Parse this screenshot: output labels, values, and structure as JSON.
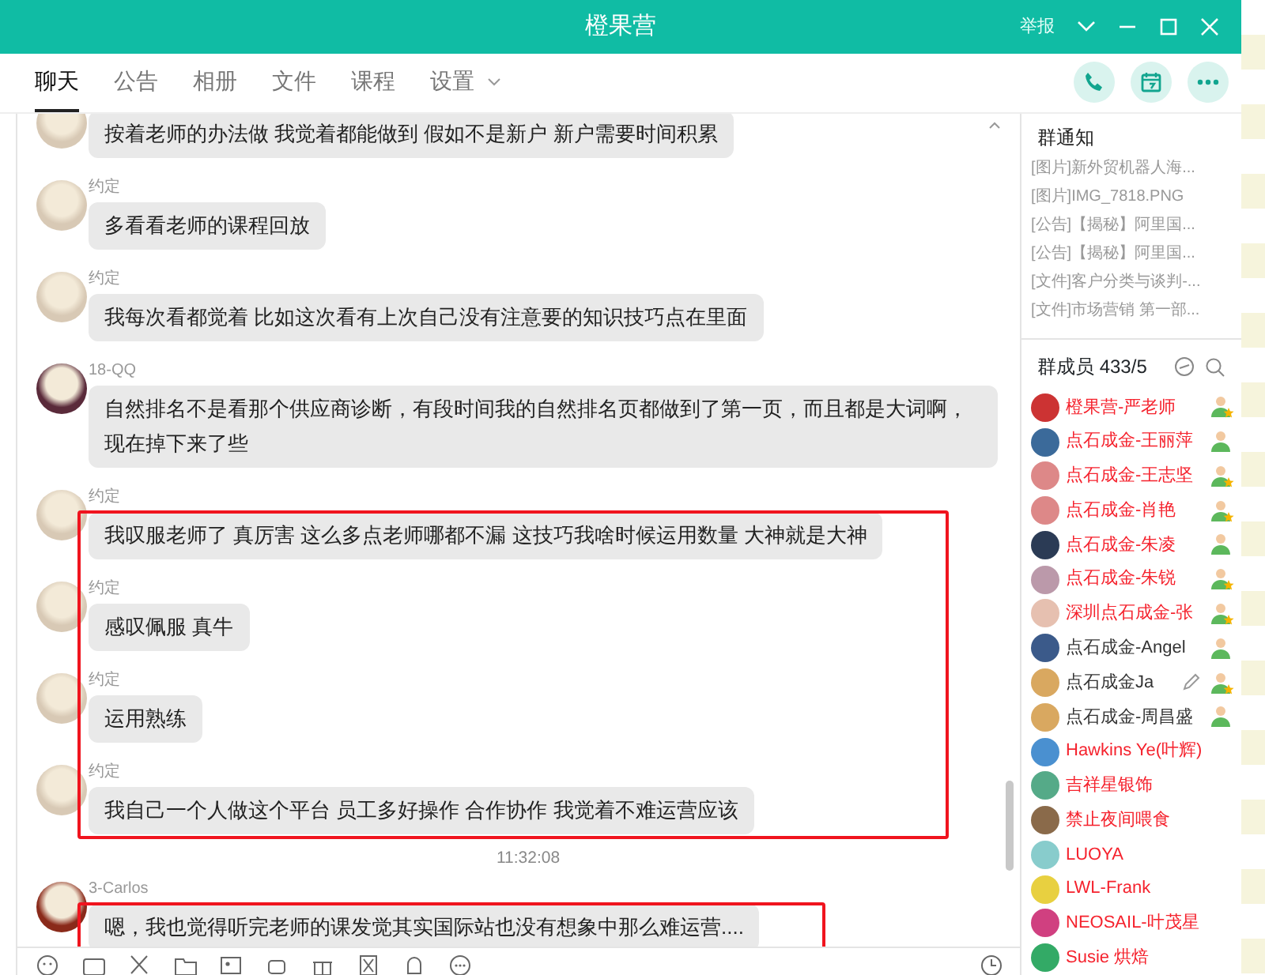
{
  "window": {
    "title": "橙果营",
    "report": "举报"
  },
  "tabs": [
    {
      "label": "聊天",
      "selected": true
    },
    {
      "label": "公告",
      "selected": false
    },
    {
      "label": "相册",
      "selected": false
    },
    {
      "label": "文件",
      "selected": false
    },
    {
      "label": "课程",
      "selected": false
    },
    {
      "label": "设置",
      "selected": false,
      "dropdown": true
    }
  ],
  "messages": [
    {
      "kind": "message",
      "text": "按着老师的办法做 我觉着都能做到 假如不是新户 新户需要时间积累",
      "highlighted": false
    },
    {
      "kind": "message",
      "sender": "约定",
      "text": "多看看老师的课程回放",
      "highlighted": false
    },
    {
      "kind": "message",
      "sender": "约定",
      "text": "我每次看都觉着 比如这次看有上次自己没有注意要的知识技巧点在里面",
      "highlighted": false
    },
    {
      "kind": "message",
      "sender": "18-QQ",
      "text": "自然排名不是看那个供应商诊断，有段时间我的自然排名页都做到了第一页，而且都是大词啊，现在掉下来了些",
      "highlighted": false
    },
    {
      "kind": "message",
      "sender": "约定",
      "text": "我叹服老师了 真厉害 这么多点老师哪都不漏 这技巧我啥时候运用数量 大神就是大神",
      "highlighted": true
    },
    {
      "kind": "message",
      "sender": "约定",
      "text": "感叹佩服 真牛",
      "highlighted": true
    },
    {
      "kind": "message",
      "sender": "约定",
      "text": "运用熟练",
      "highlighted": true
    },
    {
      "kind": "message",
      "sender": "约定",
      "text": "我自己一个人做这个平台 员工多好操作 合作协作 我觉着不难运营应该",
      "highlighted": true
    },
    {
      "kind": "time",
      "text": "11:32:08"
    },
    {
      "kind": "message",
      "sender": "3-Carlos",
      "text": "嗯，我也觉得听完老师的课发觉其实国际站也没有想象中那么难运营....",
      "highlighted": true
    }
  ],
  "notice": {
    "title": "群通知",
    "items": [
      {
        "tag": "[图片]",
        "text": "新外贸机器人海..."
      },
      {
        "tag": "[图片]",
        "text": "IMG_7818.PNG"
      },
      {
        "tag": "[公告]",
        "text": "【揭秘】阿里国..."
      },
      {
        "tag": "[公告]",
        "text": "【揭秘】阿里国..."
      },
      {
        "tag": "[文件]",
        "text": "客户分类与谈判-..."
      },
      {
        "tag": "[文件]",
        "text": "市场营销 第一部..."
      }
    ]
  },
  "members": {
    "title": "群成员 433/5",
    "items": [
      {
        "name": "橙果营-严老师",
        "color": "#f5222d",
        "kind": "admin",
        "hovered": false
      },
      {
        "name": "点石成金-王丽萍",
        "color": "#f5222d",
        "kind": "member",
        "hovered": false
      },
      {
        "name": "点石成金-王志坚",
        "color": "#f5222d",
        "kind": "admin",
        "hovered": false
      },
      {
        "name": "点石成金-肖艳",
        "color": "#f5222d",
        "kind": "admin",
        "hovered": false
      },
      {
        "name": "点石成金-朱凌",
        "color": "#f5222d",
        "kind": "member",
        "hovered": false
      },
      {
        "name": "点石成金-朱锐",
        "color": "#f5222d",
        "kind": "admin",
        "hovered": false
      },
      {
        "name": "深圳点石成金-张",
        "color": "#f5222d",
        "kind": "admin",
        "hovered": false
      },
      {
        "name": "点石成金-Angel",
        "color": "#333333",
        "kind": "member",
        "hovered": false
      },
      {
        "name": "点石成金Ja",
        "color": "#333333",
        "kind": "admin",
        "hovered": true
      },
      {
        "name": "点石成金-周昌盛",
        "color": "#333333",
        "kind": "member",
        "hovered": false
      },
      {
        "name": "Hawkins Ye(叶辉)",
        "color": "#f5222d",
        "hovered": false
      },
      {
        "name": "吉祥星银饰",
        "color": "#f5222d",
        "hovered": false
      },
      {
        "name": "禁止夜间喂食",
        "color": "#f5222d",
        "hovered": false
      },
      {
        "name": "LUOYA",
        "color": "#f5222d",
        "hovered": false
      },
      {
        "name": "LWL-Frank",
        "color": "#f5222d",
        "hovered": false
      },
      {
        "name": "NEOSAIL-叶茂星",
        "color": "#f5222d",
        "hovered": false
      },
      {
        "name": "Susie 烘焙",
        "color": "#f5222d",
        "hovered": false
      }
    ]
  }
}
